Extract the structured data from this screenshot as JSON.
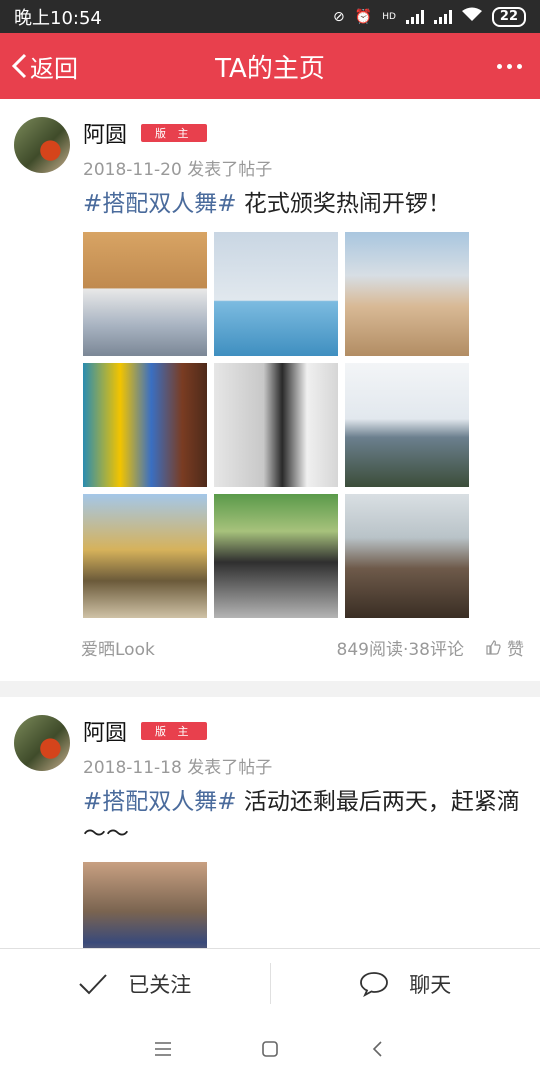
{
  "status_bar": {
    "time": "晚上10:54",
    "network_label": "HD",
    "battery": "22"
  },
  "nav": {
    "back_label": "返回",
    "title": "TA的主页"
  },
  "posts": [
    {
      "author": "阿圆",
      "badge": "版 主",
      "meta": "2018-11-20 发表了帖子",
      "tag": "#搭配双人舞#",
      "text": " 花式颁奖热闹开锣！",
      "photo_count": 9,
      "source": "爱晒Look",
      "stats": "849阅读·38评论",
      "like_label": "赞"
    },
    {
      "author": "阿圆",
      "badge": "版 主",
      "meta": "2018-11-18 发表了帖子",
      "tag": "#搭配双人舞#",
      "text": " 活动还剩最后两天，赶紧滴～～",
      "photo_count": 1
    }
  ],
  "actions": {
    "follow_label": "已关注",
    "chat_label": "聊天"
  }
}
